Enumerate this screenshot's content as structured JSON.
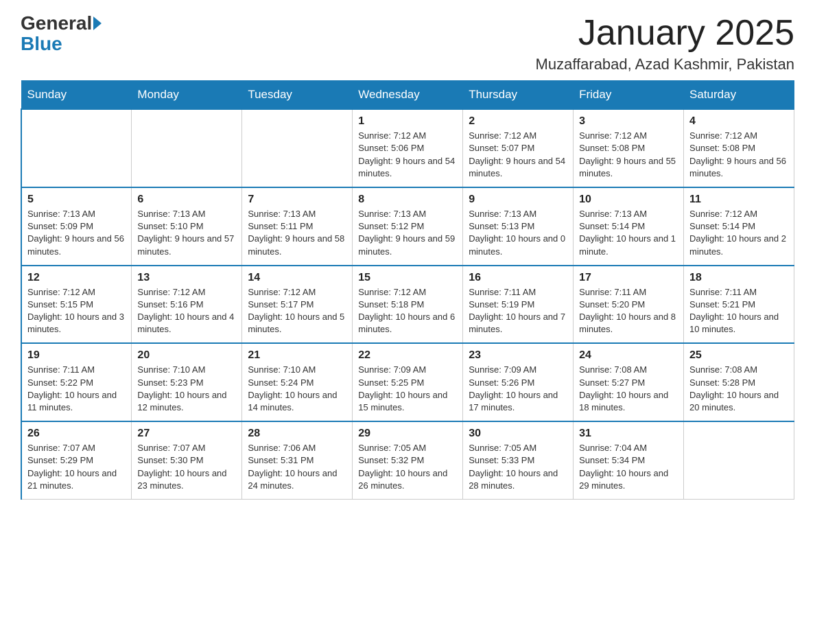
{
  "header": {
    "logo_general": "General",
    "logo_blue": "Blue",
    "month_year": "January 2025",
    "location": "Muzaffarabad, Azad Kashmir, Pakistan"
  },
  "days_of_week": [
    "Sunday",
    "Monday",
    "Tuesday",
    "Wednesday",
    "Thursday",
    "Friday",
    "Saturday"
  ],
  "weeks": [
    [
      {
        "day": "",
        "info": ""
      },
      {
        "day": "",
        "info": ""
      },
      {
        "day": "",
        "info": ""
      },
      {
        "day": "1",
        "info": "Sunrise: 7:12 AM\nSunset: 5:06 PM\nDaylight: 9 hours and 54 minutes."
      },
      {
        "day": "2",
        "info": "Sunrise: 7:12 AM\nSunset: 5:07 PM\nDaylight: 9 hours and 54 minutes."
      },
      {
        "day": "3",
        "info": "Sunrise: 7:12 AM\nSunset: 5:08 PM\nDaylight: 9 hours and 55 minutes."
      },
      {
        "day": "4",
        "info": "Sunrise: 7:12 AM\nSunset: 5:08 PM\nDaylight: 9 hours and 56 minutes."
      }
    ],
    [
      {
        "day": "5",
        "info": "Sunrise: 7:13 AM\nSunset: 5:09 PM\nDaylight: 9 hours and 56 minutes."
      },
      {
        "day": "6",
        "info": "Sunrise: 7:13 AM\nSunset: 5:10 PM\nDaylight: 9 hours and 57 minutes."
      },
      {
        "day": "7",
        "info": "Sunrise: 7:13 AM\nSunset: 5:11 PM\nDaylight: 9 hours and 58 minutes."
      },
      {
        "day": "8",
        "info": "Sunrise: 7:13 AM\nSunset: 5:12 PM\nDaylight: 9 hours and 59 minutes."
      },
      {
        "day": "9",
        "info": "Sunrise: 7:13 AM\nSunset: 5:13 PM\nDaylight: 10 hours and 0 minutes."
      },
      {
        "day": "10",
        "info": "Sunrise: 7:13 AM\nSunset: 5:14 PM\nDaylight: 10 hours and 1 minute."
      },
      {
        "day": "11",
        "info": "Sunrise: 7:12 AM\nSunset: 5:14 PM\nDaylight: 10 hours and 2 minutes."
      }
    ],
    [
      {
        "day": "12",
        "info": "Sunrise: 7:12 AM\nSunset: 5:15 PM\nDaylight: 10 hours and 3 minutes."
      },
      {
        "day": "13",
        "info": "Sunrise: 7:12 AM\nSunset: 5:16 PM\nDaylight: 10 hours and 4 minutes."
      },
      {
        "day": "14",
        "info": "Sunrise: 7:12 AM\nSunset: 5:17 PM\nDaylight: 10 hours and 5 minutes."
      },
      {
        "day": "15",
        "info": "Sunrise: 7:12 AM\nSunset: 5:18 PM\nDaylight: 10 hours and 6 minutes."
      },
      {
        "day": "16",
        "info": "Sunrise: 7:11 AM\nSunset: 5:19 PM\nDaylight: 10 hours and 7 minutes."
      },
      {
        "day": "17",
        "info": "Sunrise: 7:11 AM\nSunset: 5:20 PM\nDaylight: 10 hours and 8 minutes."
      },
      {
        "day": "18",
        "info": "Sunrise: 7:11 AM\nSunset: 5:21 PM\nDaylight: 10 hours and 10 minutes."
      }
    ],
    [
      {
        "day": "19",
        "info": "Sunrise: 7:11 AM\nSunset: 5:22 PM\nDaylight: 10 hours and 11 minutes."
      },
      {
        "day": "20",
        "info": "Sunrise: 7:10 AM\nSunset: 5:23 PM\nDaylight: 10 hours and 12 minutes."
      },
      {
        "day": "21",
        "info": "Sunrise: 7:10 AM\nSunset: 5:24 PM\nDaylight: 10 hours and 14 minutes."
      },
      {
        "day": "22",
        "info": "Sunrise: 7:09 AM\nSunset: 5:25 PM\nDaylight: 10 hours and 15 minutes."
      },
      {
        "day": "23",
        "info": "Sunrise: 7:09 AM\nSunset: 5:26 PM\nDaylight: 10 hours and 17 minutes."
      },
      {
        "day": "24",
        "info": "Sunrise: 7:08 AM\nSunset: 5:27 PM\nDaylight: 10 hours and 18 minutes."
      },
      {
        "day": "25",
        "info": "Sunrise: 7:08 AM\nSunset: 5:28 PM\nDaylight: 10 hours and 20 minutes."
      }
    ],
    [
      {
        "day": "26",
        "info": "Sunrise: 7:07 AM\nSunset: 5:29 PM\nDaylight: 10 hours and 21 minutes."
      },
      {
        "day": "27",
        "info": "Sunrise: 7:07 AM\nSunset: 5:30 PM\nDaylight: 10 hours and 23 minutes."
      },
      {
        "day": "28",
        "info": "Sunrise: 7:06 AM\nSunset: 5:31 PM\nDaylight: 10 hours and 24 minutes."
      },
      {
        "day": "29",
        "info": "Sunrise: 7:05 AM\nSunset: 5:32 PM\nDaylight: 10 hours and 26 minutes."
      },
      {
        "day": "30",
        "info": "Sunrise: 7:05 AM\nSunset: 5:33 PM\nDaylight: 10 hours and 28 minutes."
      },
      {
        "day": "31",
        "info": "Sunrise: 7:04 AM\nSunset: 5:34 PM\nDaylight: 10 hours and 29 minutes."
      },
      {
        "day": "",
        "info": ""
      }
    ]
  ]
}
